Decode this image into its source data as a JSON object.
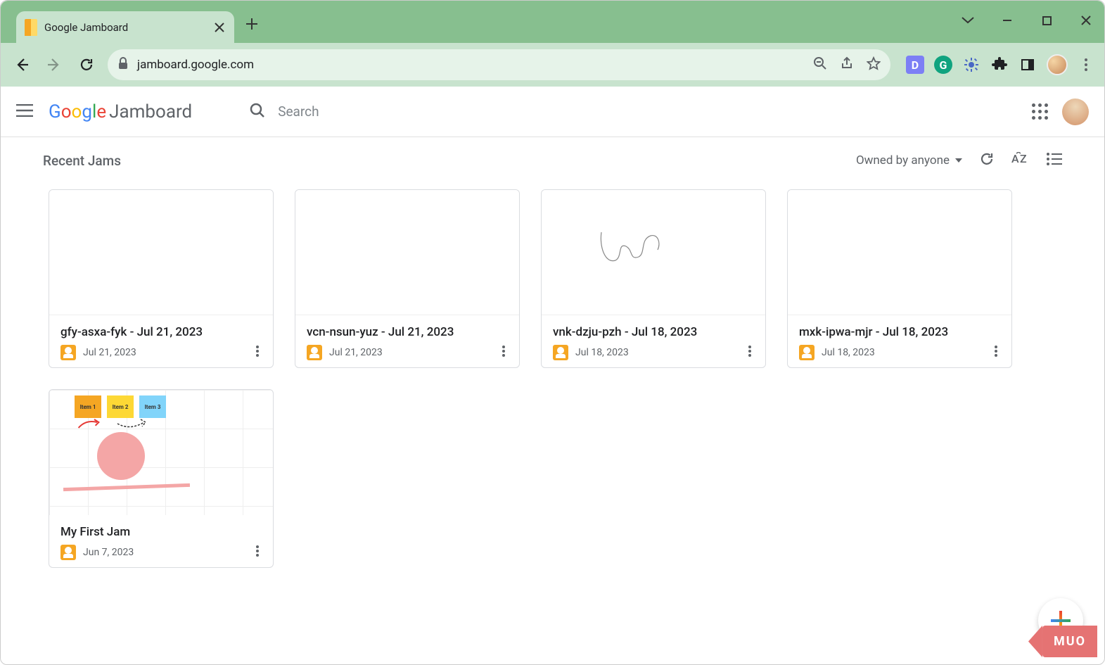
{
  "browser": {
    "tab_title": "Google Jamboard",
    "url": "jamboard.google.com"
  },
  "app": {
    "logo_text": "Jamboard",
    "search_placeholder": "Search"
  },
  "section": {
    "title": "Recent Jams",
    "owner_filter": "Owned by anyone"
  },
  "jams": [
    {
      "title": "gfy-asxa-fyk - Jul 21, 2023",
      "date": "Jul 21, 2023",
      "preview": "blank"
    },
    {
      "title": "vcn-nsun-yuz - Jul 21, 2023",
      "date": "Jul 21, 2023",
      "preview": "blank"
    },
    {
      "title": "vnk-dzju-pzh - Jul 18, 2023",
      "date": "Jul 18, 2023",
      "preview": "scribble"
    },
    {
      "title": "mxk-ipwa-mjr - Jul 18, 2023",
      "date": "Jul 18, 2023",
      "preview": "blank"
    },
    {
      "title": "My First Jam",
      "date": "Jun 7, 2023",
      "preview": "myfirst"
    }
  ],
  "sticky_labels": {
    "one": "Item 1",
    "two": "Item 2",
    "three": "Item 3"
  },
  "watermark": "MUO"
}
